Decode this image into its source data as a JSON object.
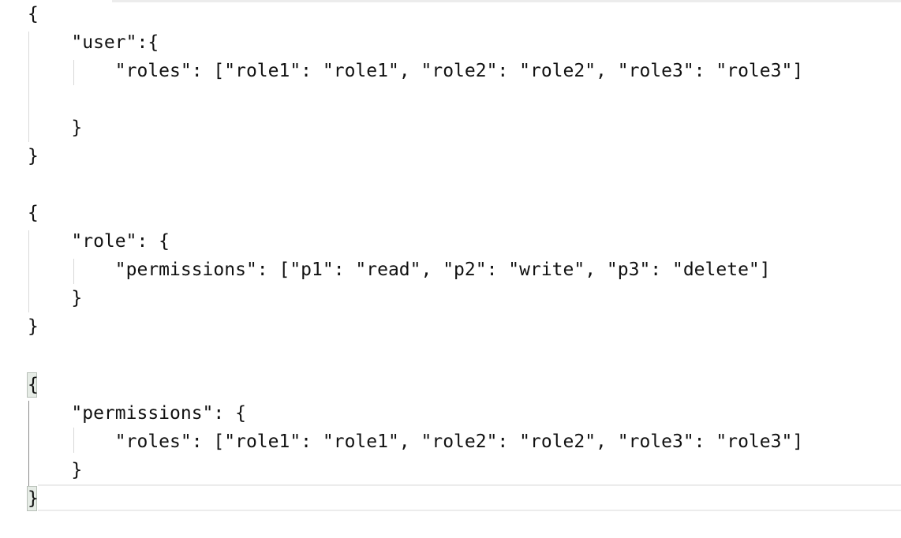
{
  "editor": {
    "lines": [
      "{",
      "    \"user\":{",
      "        \"roles\": [\"role1\": \"role1\", \"role2\": \"role2\", \"role3\": \"role3\"]",
      "",
      "    }",
      "}",
      "",
      "{",
      "    \"role\": {",
      "        \"permissions\": [\"p1\": \"read\", \"p2\": \"write\", \"p3\": \"delete\"]",
      "    }",
      "}",
      "",
      "{",
      "    \"permissions\": {",
      "        \"roles\": [\"role1\": \"role1\", \"role2\": \"role2\", \"role3\": \"role3\"]",
      "    }",
      "}"
    ],
    "matched_bracket_lines": [
      13,
      17
    ],
    "current_line": 17,
    "colors": {
      "text": "#111111",
      "indent_guide": "#d8d8d8",
      "indent_guide_active": "#8a8a8a",
      "bracket_highlight": "#e6ece6",
      "current_line_border": "#ececec"
    }
  }
}
